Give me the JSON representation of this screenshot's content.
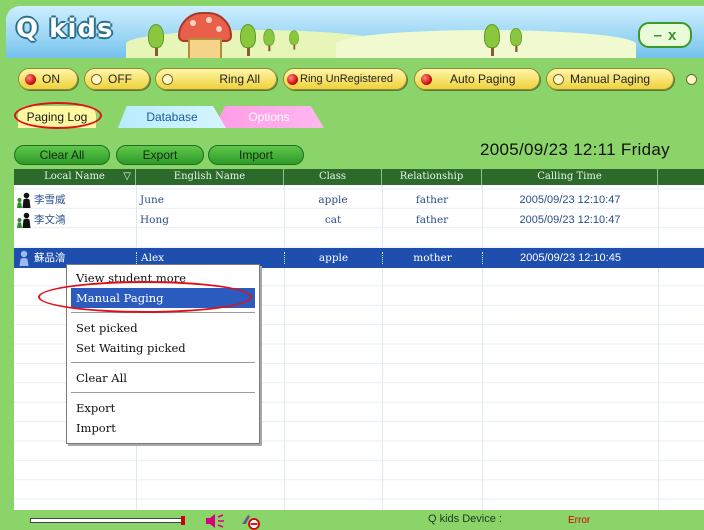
{
  "app": {
    "title": "Q kids",
    "window_buttons": {
      "minimize": "–",
      "close": "x"
    }
  },
  "toolbar": [
    {
      "label": "ON",
      "led": "red"
    },
    {
      "label": "OFF",
      "led": "off"
    },
    {
      "label": "Ring All",
      "led": "off"
    },
    {
      "label": "Ring UnRegistered",
      "led": "red"
    },
    {
      "label": "Auto Paging",
      "led": "red"
    },
    {
      "label": "Manual Paging",
      "led": "off"
    }
  ],
  "tabs": {
    "log": "Paging Log",
    "database": "Database",
    "options": "Options"
  },
  "actions": {
    "clear_all": "Clear All",
    "export": "Export",
    "import": "Import"
  },
  "datetime": "2005/09/23  12:11  Friday",
  "table": {
    "columns": [
      "Local Name",
      "English Name",
      "Class",
      "Relationship",
      "Calling Time"
    ],
    "sort_indicator": "▽",
    "rows": [
      {
        "local": "李雪威",
        "english": "June",
        "class": "apple",
        "relationship": "father",
        "time": "2005/09/23 12:10:47",
        "icon": "parent-child-icon",
        "selected": false
      },
      {
        "local": "李文鴻",
        "english": "Hong",
        "class": "cat",
        "relationship": "father",
        "time": "2005/09/23 12:10:47",
        "icon": "parent-child-icon",
        "selected": false
      },
      {
        "local": "蘇品澮",
        "english": "Alex",
        "class": "apple",
        "relationship": "mother",
        "time": "2005/09/23 12:10:45",
        "icon": "child-icon",
        "selected": true
      }
    ]
  },
  "context_menu": {
    "view_info": "View student more information",
    "manual_paging": "Manual Paging",
    "set_picked": "Set picked",
    "set_waiting": "Set Waiting picked",
    "clear_all": "Clear All",
    "export": "Export",
    "import": "Import"
  },
  "status": {
    "device_label": "Q kids Device :",
    "device_state": "Error"
  },
  "colors": {
    "background_green": "#8bd46a",
    "header_blue": "#9fd8f6",
    "table_header": "#2c6a2c",
    "selection": "#1f4fae",
    "highlight_ring": "#e0101a",
    "error_text": "#d40000"
  }
}
